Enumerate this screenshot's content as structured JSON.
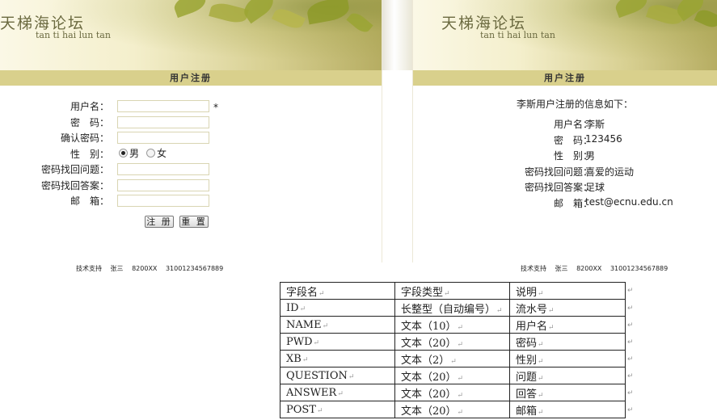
{
  "site": {
    "title_cn": "天梯海论坛",
    "title_en": "tan ti hai lun tan"
  },
  "register_form": {
    "header": "用户注册",
    "fields": [
      {
        "label": "用户名："
      },
      {
        "label": "密　码："
      },
      {
        "label": "确认密码："
      },
      {
        "label": "性　别："
      },
      {
        "label": "密码找回问题："
      },
      {
        "label": "密码找回答案："
      },
      {
        "label": "邮　箱："
      }
    ],
    "required_mark": "*",
    "gender_options": [
      "男",
      "女"
    ],
    "gender_selected": "男",
    "submit_label": "注 册",
    "reset_label": "重 置"
  },
  "result_panel": {
    "header": "用户注册",
    "intro": "李斯用户注册的信息如下：",
    "rows": [
      {
        "label": "用户名：",
        "value": "李斯"
      },
      {
        "label": "密　码：",
        "value": "123456"
      },
      {
        "label": "性　别：",
        "value": "男"
      },
      {
        "label": "密码找回问题：",
        "value": "喜爱的运动"
      },
      {
        "label": "密码找回答案：",
        "value": "足球"
      },
      {
        "label": "邮　箱：",
        "value": "test@ecnu.edu.cn"
      }
    ]
  },
  "footer": {
    "support_label": "技术支持",
    "name": "张三",
    "code": "8200XX",
    "phone": "31001234567889"
  },
  "fields_table": {
    "headers": [
      "字段名",
      "字段类型",
      "说明"
    ],
    "rows": [
      [
        "ID",
        "长整型（自动编号）",
        "流水号"
      ],
      [
        "NAME",
        "文本（10）",
        "用户名"
      ],
      [
        "PWD",
        "文本（20）",
        "密码"
      ],
      [
        "XB",
        "文本（2）",
        "性别"
      ],
      [
        "QUESTION",
        "文本（20）",
        "问题"
      ],
      [
        "ANSWER",
        "文本（20）",
        "回答"
      ],
      [
        "POST",
        "文本（20）",
        "邮箱"
      ]
    ],
    "paragraph_mark": "↵"
  }
}
